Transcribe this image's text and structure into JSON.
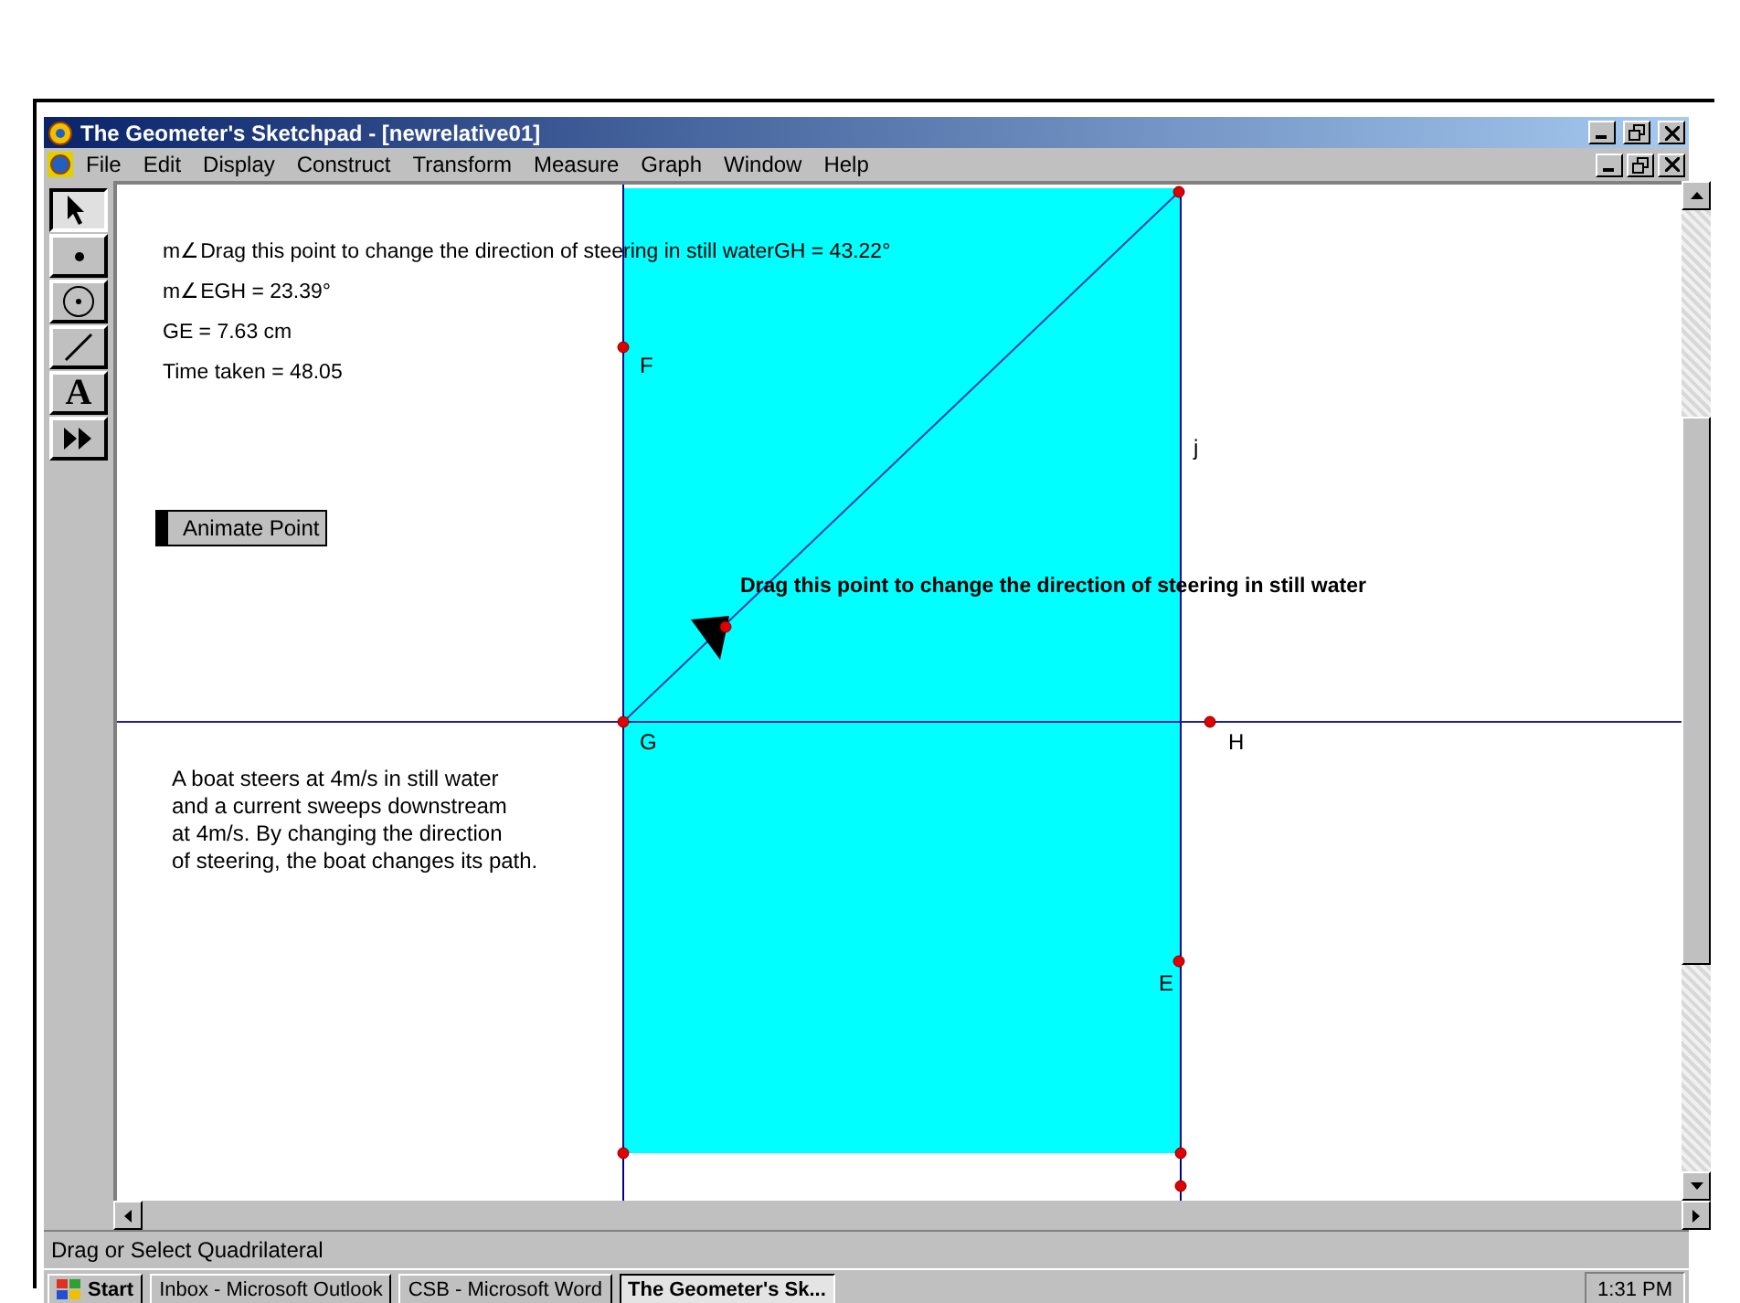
{
  "window": {
    "title": "The Geometer's Sketchpad - [newrelative01]"
  },
  "menu": [
    "File",
    "Edit",
    "Display",
    "Construct",
    "Transform",
    "Measure",
    "Graph",
    "Window",
    "Help"
  ],
  "toolbox": [
    {
      "kind": "arrow",
      "selected": true
    },
    {
      "kind": "point",
      "selected": false
    },
    {
      "kind": "compass",
      "selected": false
    },
    {
      "kind": "line",
      "selected": false
    },
    {
      "kind": "text",
      "label": "A",
      "selected": false
    },
    {
      "kind": "custom",
      "selected": false
    }
  ],
  "measurements": [
    "m∠Drag this point to change the direction of steering in still waterGH = 43.22°",
    "m∠EGH = 23.39°",
    "GE = 7.63 cm",
    "Time taken = 48.05"
  ],
  "animate_button": "Animate Point",
  "caption": "Drag this point to change the direction of steering in still water",
  "description": [
    "A boat steers at 4m/s in still water",
    "and a current sweeps downstream",
    "at 4m/s. By changing the direction",
    "of steering, the boat changes its path."
  ],
  "point_labels": [
    {
      "text": "F"
    },
    {
      "text": "j"
    },
    {
      "text": "G"
    },
    {
      "text": "H"
    },
    {
      "text": "E"
    }
  ],
  "status_bar": "Drag or Select Quadrilateral",
  "taskbar": {
    "start": "Start",
    "tasks": [
      {
        "label": "Inbox - Microsoft Outlook",
        "selected": false
      },
      {
        "label": "CSB - Microsoft Word",
        "selected": false
      },
      {
        "label": "The Geometer's Sk...",
        "selected": true
      }
    ],
    "clock": "1:31 PM"
  }
}
